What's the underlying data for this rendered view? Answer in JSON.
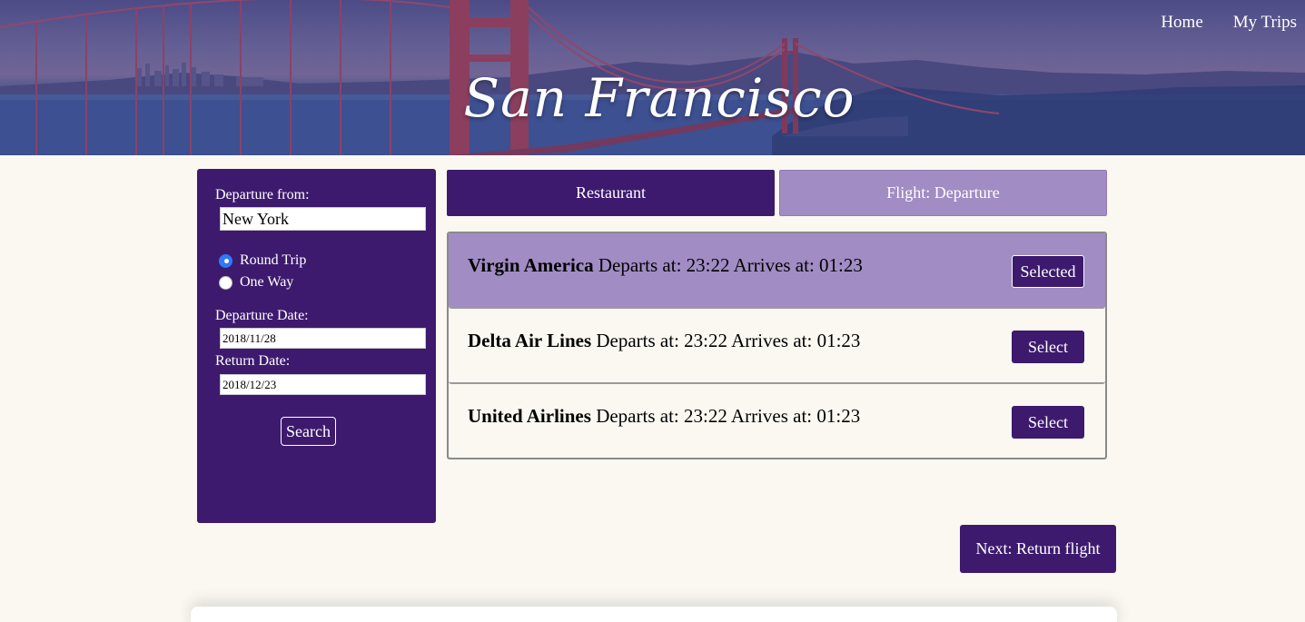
{
  "hero": {
    "title": "San Francisco"
  },
  "nav": {
    "home": "Home",
    "my_trips": "My Trips"
  },
  "sidebar": {
    "departure_label": "Departure from:",
    "departure_value": "New York",
    "trip_types": [
      {
        "label": "Round Trip",
        "selected": true
      },
      {
        "label": "One Way",
        "selected": false
      }
    ],
    "departure_date_label": "Departure Date:",
    "departure_date_value": "2018/11/28",
    "return_date_label": "Return Date:",
    "return_date_value": "2018/12/23",
    "search_label": "Search"
  },
  "tabs": {
    "restaurant": "Restaurant",
    "flight": "Flight: Departure"
  },
  "flights": [
    {
      "airline": "Virgin America",
      "details": " Departs at: 23:22 Arrives at: 01:23",
      "button": "Selected",
      "selected": true
    },
    {
      "airline": "Delta Air Lines",
      "details": " Departs at: 23:22 Arrives at: 01:23",
      "button": "Select",
      "selected": false
    },
    {
      "airline": "United Airlines",
      "details": " Departs at: 23:22 Arrives at: 01:23",
      "button": "Select",
      "selected": false
    }
  ],
  "next_label": "Next: Return flight",
  "colors": {
    "primary": "#3d1a6e",
    "accent": "#a18cc4",
    "background": "#faf8f1"
  }
}
